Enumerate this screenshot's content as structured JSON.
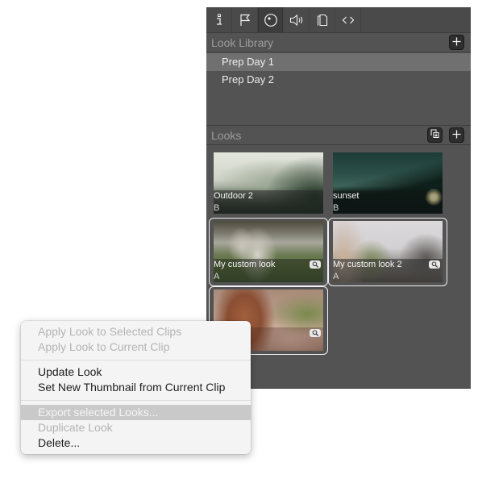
{
  "toolbar": {
    "tabs": [
      {
        "icon": "info-icon",
        "selected": false
      },
      {
        "icon": "flag-icon",
        "selected": false
      },
      {
        "icon": "looks-icon",
        "selected": true
      },
      {
        "icon": "audio-icon",
        "selected": false
      },
      {
        "icon": "metadata-icon",
        "selected": false
      },
      {
        "icon": "code-icon",
        "selected": false
      }
    ]
  },
  "look_library": {
    "title": "Look Library",
    "add_icon": "plus-icon",
    "items": [
      {
        "label": "Prep Day 1",
        "selected": true
      },
      {
        "label": "Prep Day 2",
        "selected": false
      }
    ]
  },
  "looks": {
    "title": "Looks",
    "import_icon": "import-icon",
    "add_icon": "plus-icon",
    "items": [
      {
        "name": "Outdoor 2",
        "group": "B",
        "selected": false,
        "has_zoom": false
      },
      {
        "name": "sunset",
        "group": "B",
        "selected": false,
        "has_zoom": false
      },
      {
        "name": "My custom look",
        "group": "A",
        "selected": true,
        "has_zoom": true
      },
      {
        "name": "My custom look 2",
        "group": "A",
        "selected": true,
        "has_zoom": true
      },
      {
        "name": "",
        "group": "",
        "selected": true,
        "has_zoom": true
      }
    ]
  },
  "context_menu": {
    "items": [
      {
        "label": "Apply Look to Selected Clips",
        "state": "disabled"
      },
      {
        "label": "Apply Look to Current Clip",
        "state": "disabled"
      },
      {
        "label": "Update Look",
        "state": "enabled"
      },
      {
        "label": "Set New Thumbnail from Current Clip",
        "state": "enabled"
      },
      {
        "label": "Export selected Looks...",
        "state": "highlighted"
      },
      {
        "label": "Duplicate Look",
        "state": "disabled"
      },
      {
        "label": "Delete...",
        "state": "enabled"
      }
    ]
  }
}
